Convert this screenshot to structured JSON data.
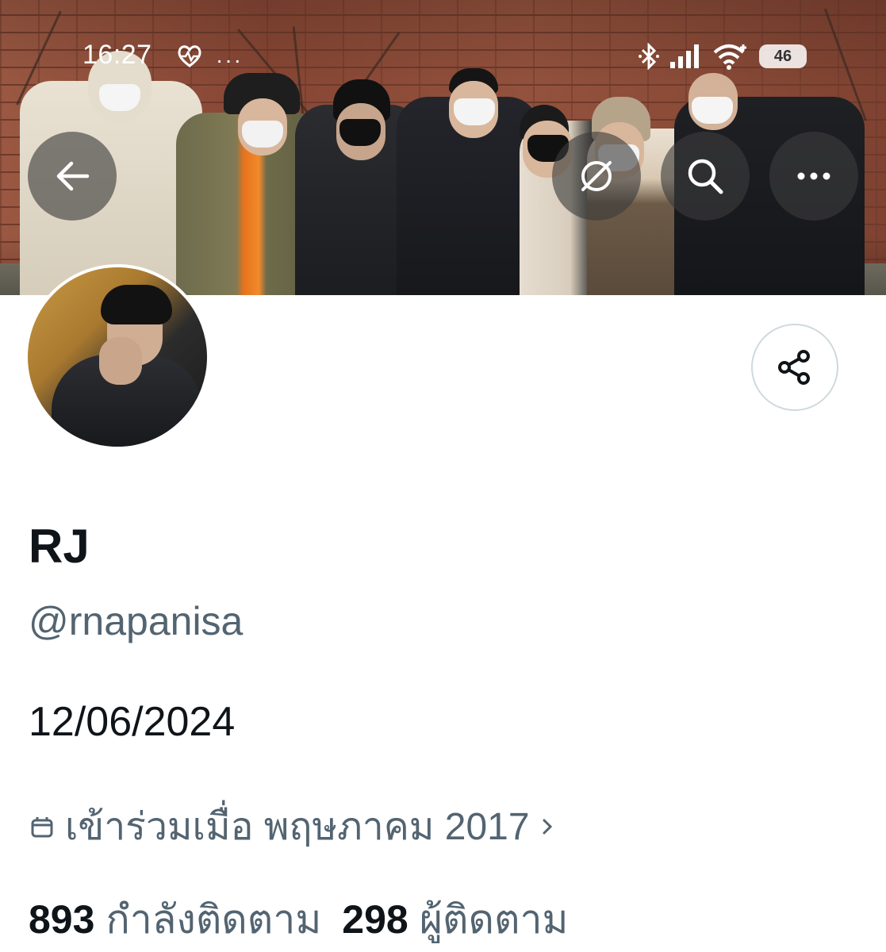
{
  "status_bar": {
    "time": "16:27",
    "battery": "46"
  },
  "profile": {
    "display_name": "RJ",
    "handle": "@rnapanisa",
    "bio": "12/06/2024",
    "joined": "เข้าร่วมเมื่อ พฤษภาคม 2017",
    "following_count": "893",
    "following_label": "กำลังติดตาม",
    "followers_count": "298",
    "followers_label": "ผู้ติดตาม"
  },
  "colors": {
    "primary_text": "#0f1419",
    "secondary_text": "#536471",
    "border": "#cfd9de"
  },
  "icons": {
    "back": "arrow-left-icon",
    "translate": "globe-slash-icon",
    "search": "search-icon",
    "more": "more-horizontal-icon",
    "share": "share-icon",
    "calendar": "calendar-icon"
  }
}
